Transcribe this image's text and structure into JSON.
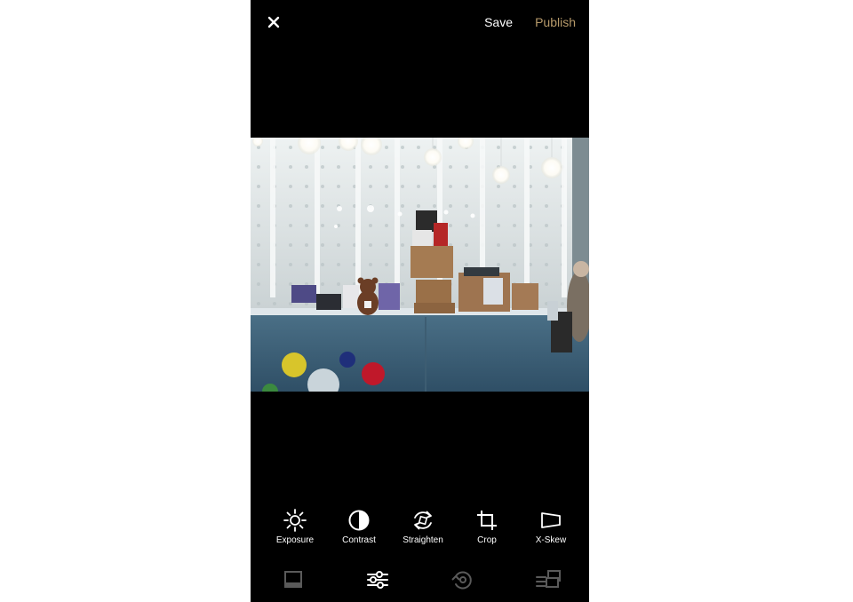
{
  "colors": {
    "background": "#000000",
    "publish_accent": "#b79a6a",
    "text_primary": "#ffffff",
    "icon_inactive": "#5a5a5a",
    "icon_active": "#ffffff"
  },
  "header": {
    "close_icon": "close-icon",
    "save_label": "Save",
    "publish_label": "Publish"
  },
  "photo": {
    "subject": "photo-preview"
  },
  "tools": [
    {
      "label": "Exposure",
      "icon": "sun-icon"
    },
    {
      "label": "Contrast",
      "icon": "contrast-icon"
    },
    {
      "label": "Straighten",
      "icon": "rotate-icon"
    },
    {
      "label": "Crop",
      "icon": "crop-icon"
    },
    {
      "label": "X-Skew",
      "icon": "skew-icon"
    }
  ],
  "bottom_nav": [
    {
      "icon": "presets-icon",
      "active": false
    },
    {
      "icon": "sliders-icon",
      "active": true
    },
    {
      "icon": "history-icon",
      "active": false
    },
    {
      "icon": "recipes-icon",
      "active": false
    }
  ]
}
